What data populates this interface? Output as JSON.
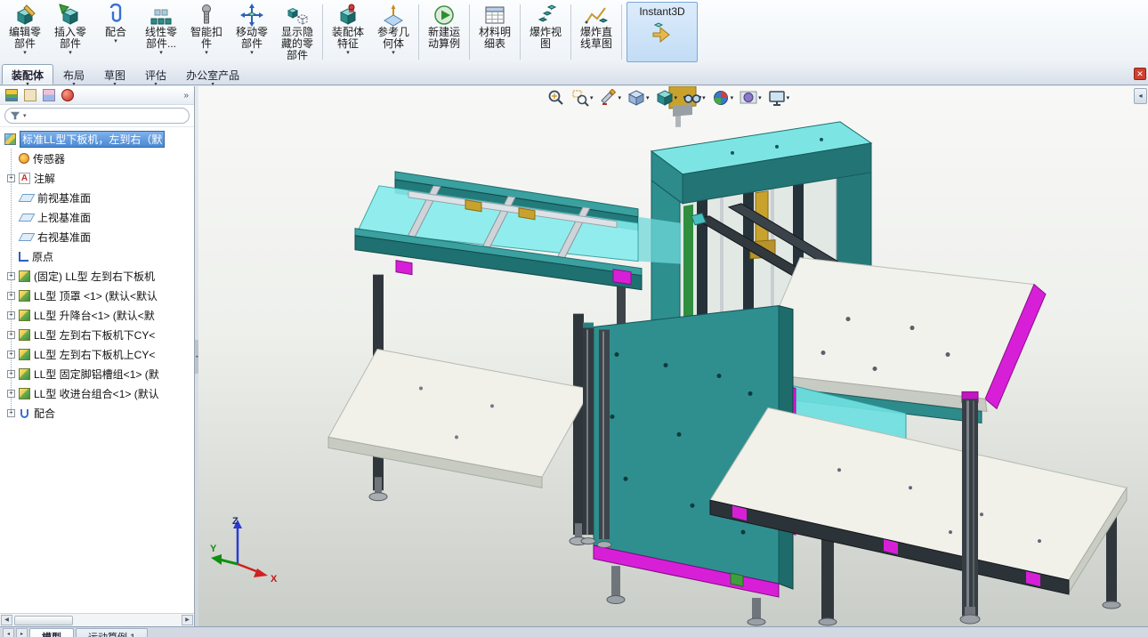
{
  "command_manager": {
    "buttons": [
      {
        "label": "编辑零部件"
      },
      {
        "label": "插入零部件"
      },
      {
        "label": "配合"
      },
      {
        "label": "线性零部件..."
      },
      {
        "label": "智能扣件"
      },
      {
        "label": "移动零部件"
      },
      {
        "label": "显示隐藏的零部件"
      },
      {
        "label": "装配体特征"
      },
      {
        "label": "参考几何体"
      },
      {
        "label": "新建运动算例"
      },
      {
        "label": "材料明细表"
      },
      {
        "label": "爆炸视图"
      },
      {
        "label": "爆炸直线草图"
      },
      {
        "label": "Instant3D"
      }
    ]
  },
  "ribbon_tabs": {
    "active": "装配体",
    "items": [
      {
        "label": "装配体"
      },
      {
        "label": "布局"
      },
      {
        "label": "草图"
      },
      {
        "label": "评估"
      },
      {
        "label": "办公室产品"
      }
    ]
  },
  "feature_manager": {
    "header_icons": [
      "featuremanager-tab",
      "propertymanager-tab",
      "configurationmanager-tab",
      "dimxpertmanager-tab",
      "overflow-chevron"
    ],
    "filter": {
      "value": "",
      "placeholder": ""
    },
    "root_label": "标准LL型下板机，左到右（默",
    "items": [
      {
        "label": "传感器",
        "icon": "sensors-icon",
        "expandable": false
      },
      {
        "label": "注解",
        "icon": "annotations-icon",
        "expandable": true
      },
      {
        "label": "前视基准面",
        "icon": "plane-icon",
        "expandable": false
      },
      {
        "label": "上视基准面",
        "icon": "plane-icon",
        "expandable": false
      },
      {
        "label": "右视基准面",
        "icon": "plane-icon",
        "expandable": false
      },
      {
        "label": "原点",
        "icon": "origin-icon",
        "expandable": false
      },
      {
        "label": "(固定) LL型 左到右下板机",
        "icon": "component-icon",
        "expandable": true
      },
      {
        "label": "LL型 顶罩 <1> (默认<默认",
        "icon": "component-icon",
        "expandable": true
      },
      {
        "label": "LL型 升降台<1> (默认<默",
        "icon": "component-icon",
        "expandable": true
      },
      {
        "label": "LL型 左到右下板机下CY<",
        "icon": "component-icon",
        "expandable": true
      },
      {
        "label": "LL型 左到右下板机上CY<",
        "icon": "component-icon",
        "expandable": true
      },
      {
        "label": "LL型 固定脚铝槽组<1> (默",
        "icon": "component-icon",
        "expandable": true
      },
      {
        "label": "LL型 收进台组合<1> (默认",
        "icon": "component-icon",
        "expandable": true
      },
      {
        "label": "配合",
        "icon": "mates-icon",
        "expandable": true
      }
    ]
  },
  "viewport": {
    "heads_up_icons": [
      "zoom-to-fit",
      "zoom-to-area",
      "section-view",
      "view-orientation",
      "display-style",
      "hide-show-items",
      "edit-appearance",
      "apply-scene",
      "view-settings"
    ],
    "triad": {
      "x": "X",
      "y": "Y",
      "z": "Z"
    },
    "model_colors": {
      "teal": "#2e8b8b",
      "cyan": "#7de4e4",
      "magenta": "#d81fd8",
      "frame_dark": "#31383d",
      "platform_white": "#f1f1ea",
      "gold": "#c9a22e"
    }
  },
  "model_tabs": {
    "items": [
      {
        "label": "模型",
        "active": true
      },
      {
        "label": "运动算例 1",
        "active": false
      }
    ]
  }
}
